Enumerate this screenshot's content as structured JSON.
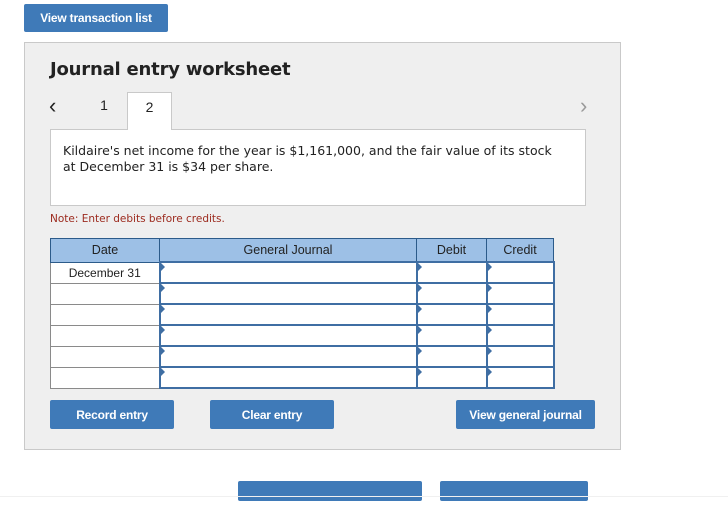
{
  "top_button": "View transaction list",
  "worksheet": {
    "title": "Journal entry worksheet",
    "tabs": [
      "1",
      "2"
    ],
    "active_tab": "2",
    "description_line1": "Kildaire's net income for the year is $1,161,000, and the fair value of its stock",
    "description_line2": "at December 31 is $34 per share.",
    "note": "Note: Enter debits before credits."
  },
  "table": {
    "headers": {
      "date": "Date",
      "journal": "General Journal",
      "debit": "Debit",
      "credit": "Credit"
    },
    "rows": [
      {
        "date": "December 31",
        "journal": "",
        "debit": "",
        "credit": ""
      },
      {
        "date": "",
        "journal": "",
        "debit": "",
        "credit": ""
      },
      {
        "date": "",
        "journal": "",
        "debit": "",
        "credit": ""
      },
      {
        "date": "",
        "journal": "",
        "debit": "",
        "credit": ""
      },
      {
        "date": "",
        "journal": "",
        "debit": "",
        "credit": ""
      },
      {
        "date": "",
        "journal": "",
        "debit": "",
        "credit": ""
      }
    ]
  },
  "buttons": {
    "record": "Record entry",
    "clear": "Clear entry",
    "view_journal": "View general journal"
  },
  "colors": {
    "accent": "#3f7ab8",
    "header_bg": "#9dc0e6",
    "note": "#9c2a1e"
  },
  "icons": {
    "prev": "chevron-left-icon",
    "next": "chevron-right-icon"
  }
}
